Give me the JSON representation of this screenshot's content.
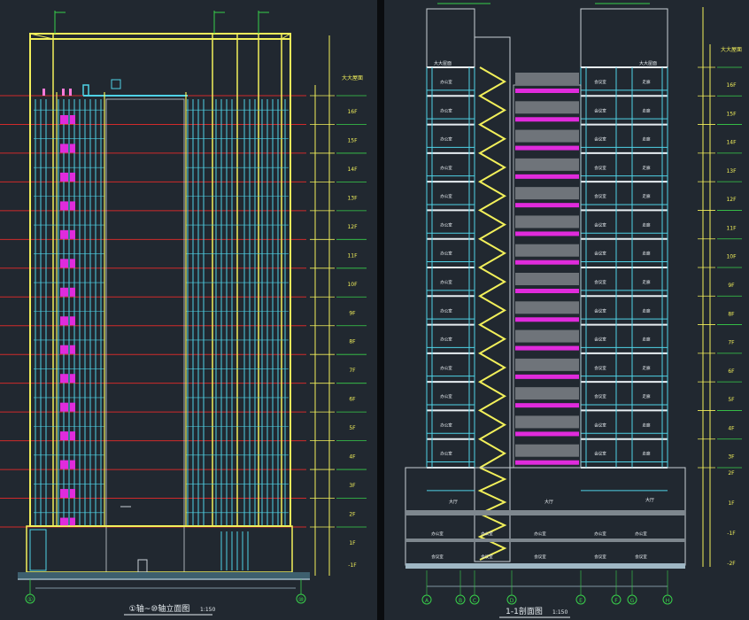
{
  "left_drawing": {
    "title": "①轴~⑩轴立面图",
    "scale": "1:150",
    "floor_labels": [
      "大大屋面",
      "16F",
      "15F",
      "14F",
      "13F",
      "12F",
      "11F",
      "10F",
      "9F",
      "8F",
      "7F",
      "6F",
      "5F",
      "4F",
      "3F",
      "2F",
      "1F",
      "-1F"
    ],
    "axis_bubbles": [
      "①",
      "⑩"
    ]
  },
  "right_drawing": {
    "title": "1-1剖面图",
    "scale": "1:150",
    "axis_bubbles": [
      "A",
      "B",
      "C",
      "D",
      "E",
      "F",
      "G",
      "H"
    ],
    "floor_labels": [
      "大大屋面",
      "16F",
      "15F",
      "14F",
      "13F",
      "12F",
      "11F",
      "10F",
      "9F",
      "8F",
      "7F",
      "6F",
      "5F",
      "4F",
      "3F",
      "2F",
      "1F",
      "-1F",
      "-2F"
    ],
    "room_labels": [
      "大大屋面",
      "办公室",
      "会议室",
      "走廊",
      "大厅"
    ]
  },
  "colors": {
    "background": "#212830",
    "window_mullion": "#4fd2e6",
    "frame_yellow": "#f2f05a",
    "accent_magenta": "#e02bdc",
    "level_line_red": "#d12a2a",
    "floor_slab_white": "#e8eef2",
    "dimension_green": "#38d04a"
  }
}
